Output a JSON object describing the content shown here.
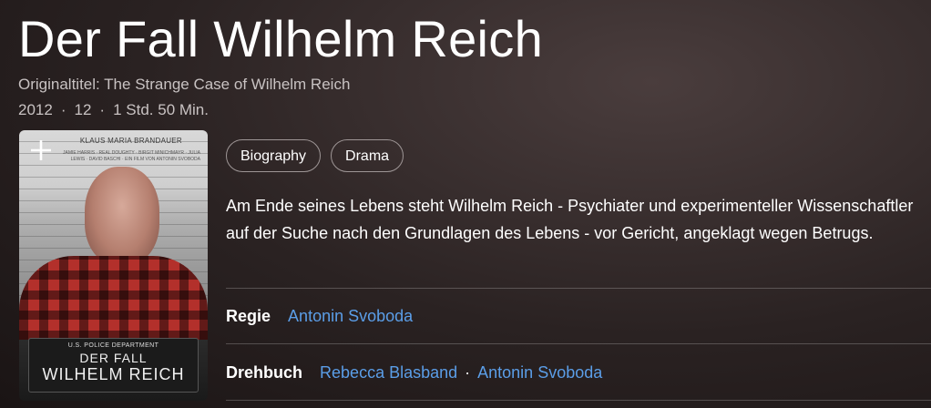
{
  "movie": {
    "title": "Der Fall Wilhelm Reich",
    "original_title": "Originaltitel: The Strange Case of Wilhelm Reich",
    "year": "2012",
    "rating": "12",
    "runtime": "1 Std. 50 Min.",
    "meta_separator": "·",
    "genres": [
      "Biography",
      "Drama"
    ],
    "description": "Am Ende seines Lebens steht Wilhelm Reich - Psychiater und experimenteller Wissenschaftler auf der Suche nach den Grundlagen des Lebens - vor Gericht, angeklagt wegen Betrugs."
  },
  "poster": {
    "actor": "KLAUS MARIA BRANDAUER",
    "credits": "JAMIE HARRIS · REAL DOUGHTY · BIRGIT MINICHMAYR · JULIA LEWIS · DAVID BASCHI · EIN FILM VON ANTONIN SVOBODA",
    "department": "U.S. POLICE DEPARTMENT",
    "plate_line1": "DER FALL",
    "plate_line2": "WILHELM REICH",
    "add_icon": "plus-icon"
  },
  "credits": {
    "director_label": "Regie",
    "director": "Antonin Svoboda",
    "writers_label": "Drehbuch",
    "writers": [
      "Rebecca Blasband",
      "Antonin Svoboda"
    ],
    "separator": "·"
  },
  "colors": {
    "link": "#5b9ee8",
    "background": "#2a2222",
    "chip_border": "#9e9696"
  }
}
